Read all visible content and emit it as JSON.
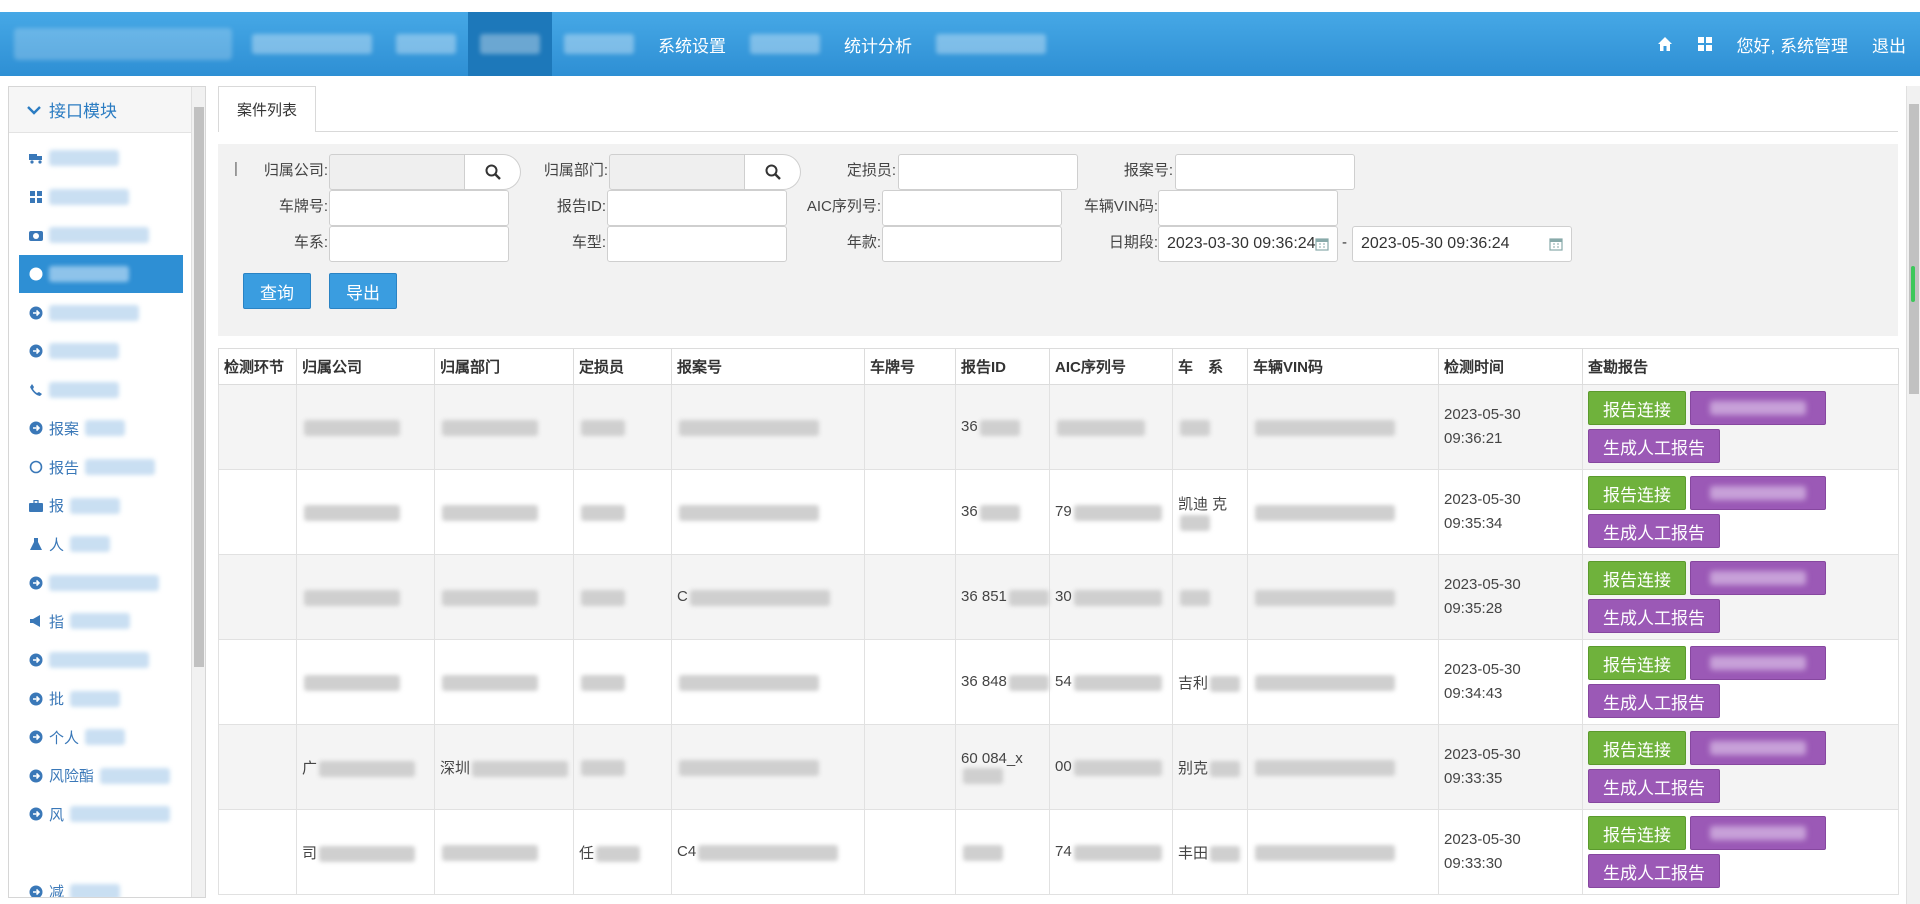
{
  "topbar": {
    "nav": [
      {
        "label": "",
        "blurred": true,
        "w": 120
      },
      {
        "label": "",
        "blurred": true,
        "w": 60
      },
      {
        "label": "",
        "blurred": true,
        "w": 60,
        "active": true
      },
      {
        "label": "",
        "blurred": true,
        "w": 70
      },
      {
        "label": "系统设置",
        "blurred": false
      },
      {
        "label": "",
        "blurred": true,
        "w": 70
      },
      {
        "label": "统计分析",
        "blurred": false
      },
      {
        "label": "",
        "blurred": true,
        "w": 110
      }
    ],
    "greeting": "您好, 系统管理",
    "logout": "退出"
  },
  "sidebar": {
    "module_title": "接口模块",
    "items": [
      {
        "icon": "truck-icon",
        "label": "",
        "blur_w": 70
      },
      {
        "icon": "grid-icon",
        "label": "",
        "blur_w": 80
      },
      {
        "icon": "camera-icon",
        "label": "",
        "blur_w": 100
      },
      {
        "icon": "circle-arrow-icon",
        "label": "",
        "blur_w": 80,
        "active": true
      },
      {
        "icon": "circle-arrow-icon",
        "label": "",
        "blur_w": 90
      },
      {
        "icon": "circle-arrow-icon",
        "label": "",
        "blur_w": 70
      },
      {
        "icon": "phone-icon",
        "label": "",
        "blur_w": 70
      },
      {
        "icon": "circle-arrow-icon",
        "label": "报案",
        "blur_w": 40
      },
      {
        "icon": "circle-icon",
        "label": "报告",
        "blur_w": 70
      },
      {
        "icon": "briefcase-icon",
        "label": "报",
        "blur_w": 50
      },
      {
        "icon": "flask-icon",
        "label": "人",
        "blur_w": 40
      },
      {
        "icon": "circle-arrow-icon",
        "label": "",
        "blur_w": 110
      },
      {
        "icon": "megaphone-icon",
        "label": "指",
        "blur_w": 60
      },
      {
        "icon": "circle-arrow-icon",
        "label": "",
        "blur_w": 100
      },
      {
        "icon": "circle-arrow-icon",
        "label": "批",
        "blur_w": 50
      },
      {
        "icon": "circle-arrow-icon",
        "label": "个人",
        "blur_w": 40
      },
      {
        "icon": "circle-arrow-icon",
        "label": "风险酯",
        "blur_w": 70
      },
      {
        "icon": "circle-arrow-icon",
        "label": "风",
        "blur_w": 100
      },
      {
        "icon": "",
        "label": "",
        "blur_w": 0
      },
      {
        "icon": "circle-arrow-icon",
        "label": "减",
        "blur_w": 50
      }
    ]
  },
  "tabs": [
    {
      "label": "案件列表"
    }
  ],
  "filters": {
    "company_label": "归属公司:",
    "dept_label": "归属部门:",
    "assessor_label": "定损员:",
    "case_no_label": "报案号:",
    "plate_label": "车牌号:",
    "report_id_label": "报告ID:",
    "aic_label": "AIC序列号:",
    "vin_label": "车辆VIN码:",
    "series_label": "车系:",
    "model_label": "车型:",
    "year_label": "年款:",
    "date_label": "日期段:",
    "date_from": "2023-03-30 09:36:24",
    "date_sep": "-",
    "date_to": "2023-05-30 09:36:24",
    "query_btn": "查询",
    "export_btn": "导出"
  },
  "table": {
    "columns": [
      "检测环节",
      "归属公司",
      "归属部门",
      "定损员",
      "报案号",
      "车牌号",
      "报告ID",
      "AIC序列号",
      "车　系",
      "车辆VIN码",
      "检测时间",
      "查勘报告"
    ],
    "rows": [
      {
        "company": "",
        "dept": "",
        "assessor": "",
        "case_no": "",
        "plate": "",
        "report_id": "36",
        "aic": "",
        "series": "",
        "vin": "",
        "time1": "2023-05-30",
        "time2": "09:36:21"
      },
      {
        "company": "",
        "dept": "",
        "assessor": "",
        "case_no": "",
        "plate": "",
        "report_id": "36",
        "aic": "79",
        "series": "凯迪 克",
        "vin": "",
        "time1": "2023-05-30",
        "time2": "09:35:34"
      },
      {
        "company": "",
        "dept": "",
        "assessor": "",
        "case_no": "C",
        "plate": "",
        "report_id": "36 851",
        "aic": "30",
        "series": "",
        "vin": "",
        "time1": "2023-05-30",
        "time2": "09:35:28"
      },
      {
        "company": "",
        "dept": "",
        "assessor": "",
        "case_no": "",
        "plate": "",
        "report_id": "36 848",
        "aic": "54",
        "series": "吉利",
        "vin": "",
        "time1": "2023-05-30",
        "time2": "09:34:43"
      },
      {
        "company": "广",
        "dept": "深圳",
        "assessor": "",
        "case_no": "",
        "plate": "",
        "report_id": "60 084_x",
        "aic": "00",
        "series": "别克",
        "vin": "",
        "time1": "2023-05-30",
        "time2": "09:33:35"
      },
      {
        "company": "司",
        "dept": "",
        "assessor": "任",
        "case_no": "C4",
        "plate": "",
        "report_id": "",
        "aic": "74",
        "series": "丰田",
        "vin": "",
        "time1": "2023-05-30",
        "time2": "09:33:30"
      }
    ],
    "report_link_btn": "报告连接",
    "manual_report_btn": "生成人工报告"
  }
}
